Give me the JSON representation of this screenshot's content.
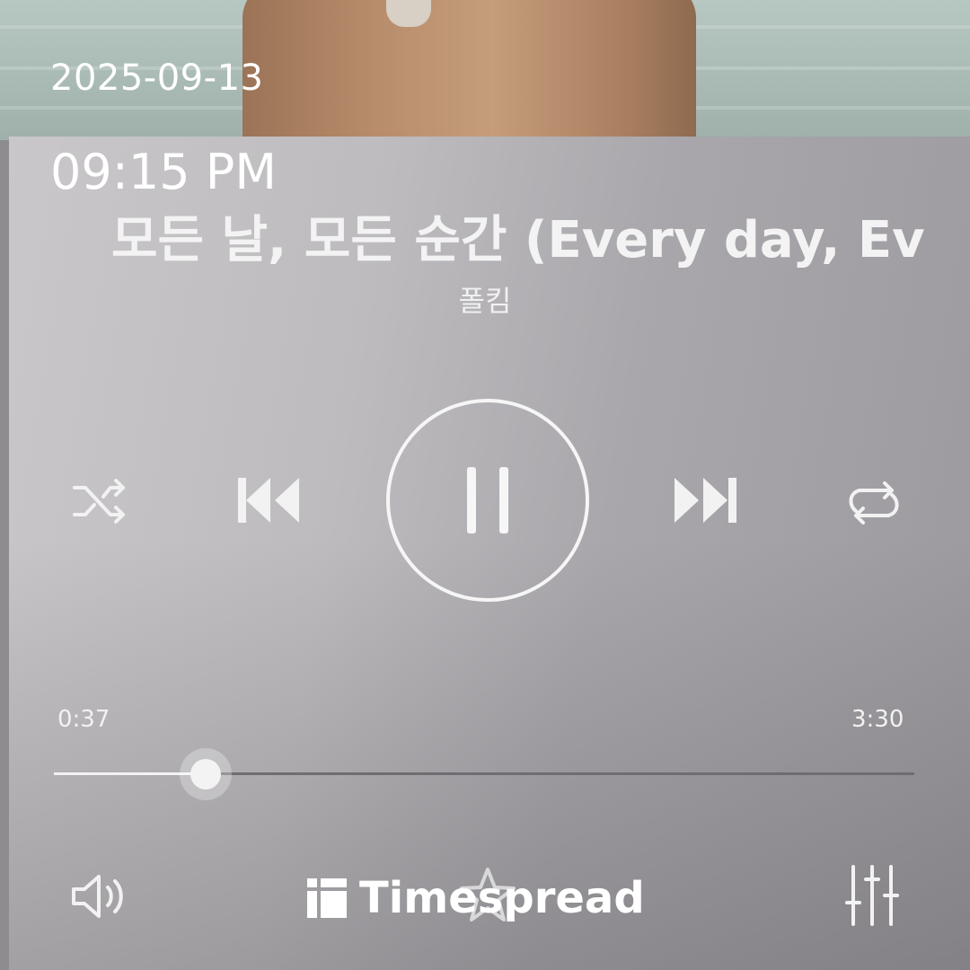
{
  "overlay": {
    "date": "2025-09-13",
    "time": "09:15 PM"
  },
  "song": {
    "title": "모든 날, 모든 순간 (Every day, Eve",
    "artist": "폴킴"
  },
  "controls": {
    "shuffle": "shuffle-icon",
    "previous": "skip-previous-icon",
    "play_pause": "pause-icon",
    "next": "skip-next-icon",
    "repeat": "repeat-icon",
    "volume": "volume-icon",
    "favorite": "star-icon",
    "equalizer": "equalizer-icon"
  },
  "progress": {
    "current": "0:37",
    "total": "3:30",
    "fraction": 0.176
  },
  "watermark": {
    "text": "Timespread"
  },
  "colors": {
    "accent": "#f3f3f3",
    "panel": "#bdbbbe",
    "track": "#6f6d71"
  }
}
